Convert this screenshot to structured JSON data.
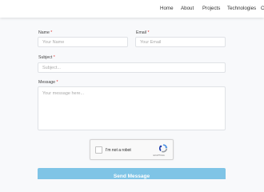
{
  "nav": {
    "items": [
      "Home",
      "About",
      "Projects",
      "Technologies",
      "C"
    ]
  },
  "form": {
    "name_label": "Name",
    "name_placeholder": "Your Name",
    "email_label": "Email",
    "email_placeholder": "Your Email",
    "subject_label": "Subject",
    "subject_placeholder": "Subject...",
    "message_label": "Message",
    "message_placeholder": "Your message here...",
    "required_mark": "*",
    "captcha_label": "I'm not a robot",
    "captcha_brand": "reCAPTCHA",
    "send_label": "Send Message"
  },
  "colors": {
    "required": "#e0332f",
    "send_button": "#7fc4e6"
  }
}
